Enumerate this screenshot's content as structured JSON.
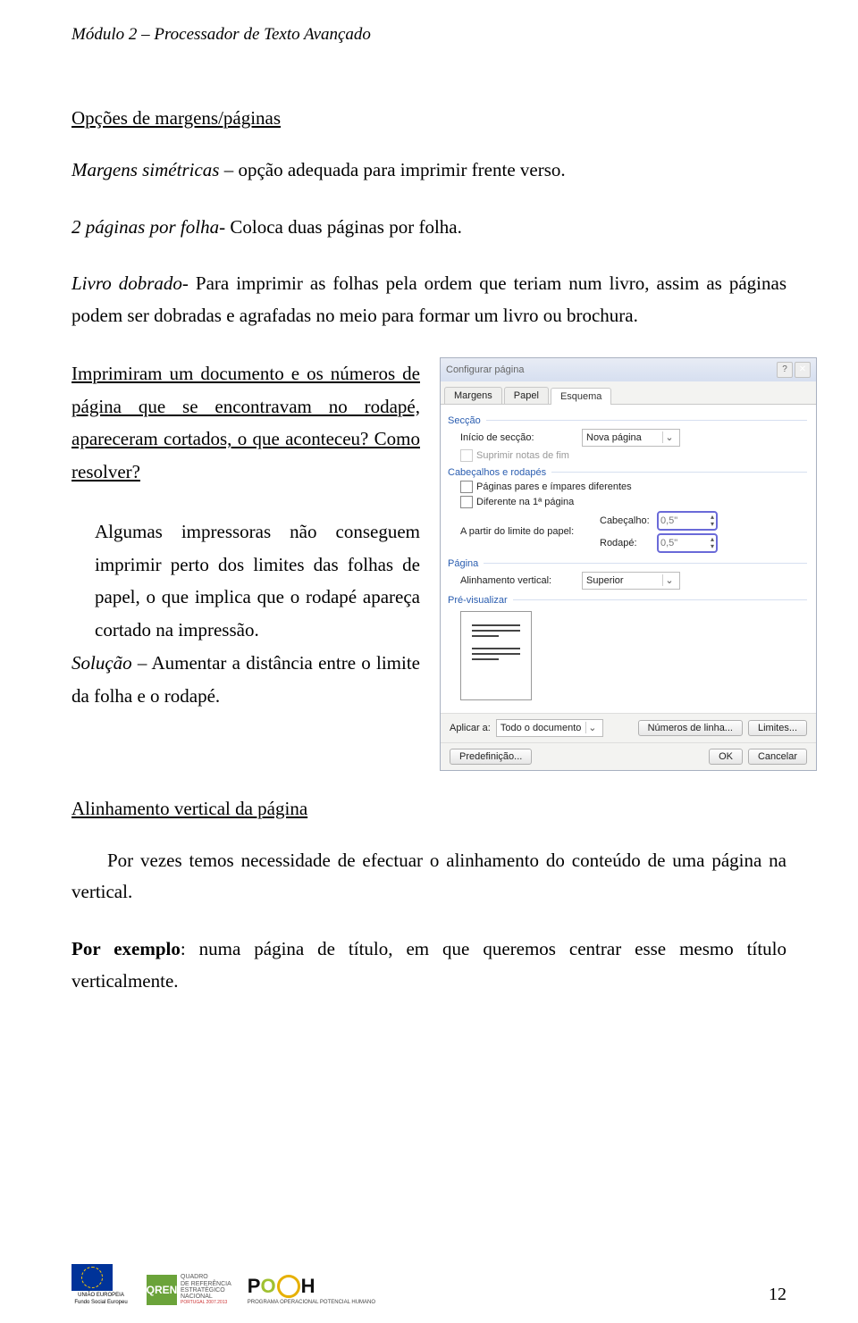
{
  "header": "Módulo 2 – Processador de Texto Avançado",
  "title1": "Opções de margens/páginas",
  "p1a": "Margens simétricas",
  "p1b": " – opção adequada para imprimir frente verso.",
  "p2a": "2 páginas por folha",
  "p2b": "- Coloca duas páginas por folha.",
  "p3a": "Livro dobrado",
  "p3b": "- Para imprimir as folhas pela ordem que teriam num livro, assim as páginas podem ser dobradas e agrafadas no meio para formar um livro ou brochura.",
  "q1": "Imprimiram um documento e os números de página que se encontravam no rodapé, apareceram cortados, o que aconteceu? Como resolver?",
  "a1": "Algumas impressoras não conseguem imprimir perto dos limites das folhas de papel, o que implica que o rodapé apareça cortado na impressão.",
  "sol_lbl": "Solução",
  "sol_txt": " – Aumentar a distância entre o limite da folha e o rodapé.",
  "title2": "Alinhamento vertical da página",
  "p4": "Por vezes temos necessidade de efectuar o alinhamento do conteúdo de uma página na vertical.",
  "p5a": "Por exemplo",
  "p5b": ": numa página de título, em que queremos centrar esse mesmo título verticalmente.",
  "dialog": {
    "title": "Configurar página",
    "tabs": [
      "Margens",
      "Papel",
      "Esquema"
    ],
    "grp_sec": "Secção",
    "lbl_sec_start": "Início de secção:",
    "val_sec_start": "Nova página",
    "cb_suppress": "Suprimir notas de fim",
    "grp_hf": "Cabeçalhos e rodapés",
    "cb_odd_even": "Páginas pares e ímpares diferentes",
    "cb_first": "Diferente na 1ª página",
    "lbl_from_edge": "A partir do limite do papel:",
    "lbl_header": "Cabeçalho:",
    "lbl_footer": "Rodapé:",
    "val_header": "0,5\"",
    "val_footer": "0,5\"",
    "grp_page": "Página",
    "lbl_valign": "Alinhamento vertical:",
    "val_valign": "Superior",
    "grp_preview": "Pré-visualizar",
    "lbl_apply": "Aplicar a:",
    "val_apply": "Todo o documento",
    "btn_linenum": "Números de linha...",
    "btn_borders": "Limites...",
    "btn_default": "Predefinição...",
    "btn_ok": "OK",
    "btn_cancel": "Cancelar"
  },
  "footer": {
    "eu1": "UNIÃO EUROPEIA",
    "eu2": "Fundo Social Europeu",
    "qren": "QUADRO\nDE REFERÊNCIA\nESTRATÉGICO\nNACIONAL",
    "qren_sub": "PORTUGAL 2007.2013",
    "poph": "POPH",
    "poph_sub": "PROGRAMA OPERACIONAL POTENCIAL HUMANO"
  },
  "page_num": "12"
}
